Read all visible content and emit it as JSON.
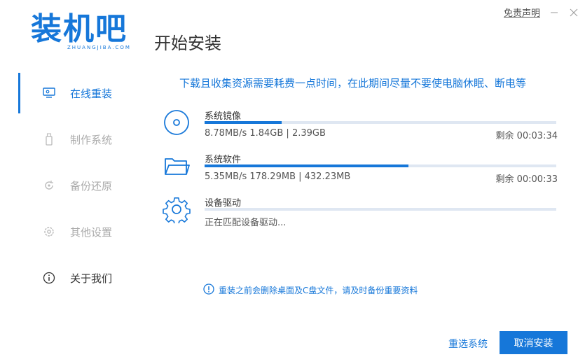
{
  "window": {
    "disclaimer_link": "免责声明"
  },
  "logo": {
    "text": "装机吧",
    "sub": "ZHUANGJIBA.COM"
  },
  "page_title": "开始安装",
  "sidebar": {
    "items": [
      {
        "label": "在线重装",
        "state": "active",
        "icon": "monitor-icon"
      },
      {
        "label": "制作系统",
        "state": "disabled",
        "icon": "usb-icon"
      },
      {
        "label": "备份还原",
        "state": "disabled",
        "icon": "backup-icon"
      },
      {
        "label": "其他设置",
        "state": "disabled",
        "icon": "gear-icon"
      },
      {
        "label": "关于我们",
        "state": "normal",
        "icon": "info-icon"
      }
    ]
  },
  "notice": "下载且收集资源需要耗费一点时间，在此期间尽量不要使电脑休眠、断电等",
  "download_items": [
    {
      "name": "系统镜像",
      "speed": "8.78MB/s 1.84GB | 2.39GB",
      "remaining": "剩余 00:03:34",
      "progress": 0.22,
      "icon": "disc-icon"
    },
    {
      "name": "系统软件",
      "speed": "5.35MB/s 178.29MB | 432.23MB",
      "remaining": "剩余 00:00:33",
      "progress": 0.58,
      "icon": "folder-icon"
    },
    {
      "name": "设备驱动",
      "speed": "正在匹配设备驱动...",
      "remaining": "",
      "progress": 0,
      "icon": "gear-icon"
    }
  ],
  "warning": "重装之前会删除桌面及C盘文件，请及时备份重要资料",
  "buttons": {
    "reselect": "重选系统",
    "cancel": "取消安装"
  },
  "colors": {
    "accent": "#1677d9",
    "track": "#dfe7f2"
  }
}
